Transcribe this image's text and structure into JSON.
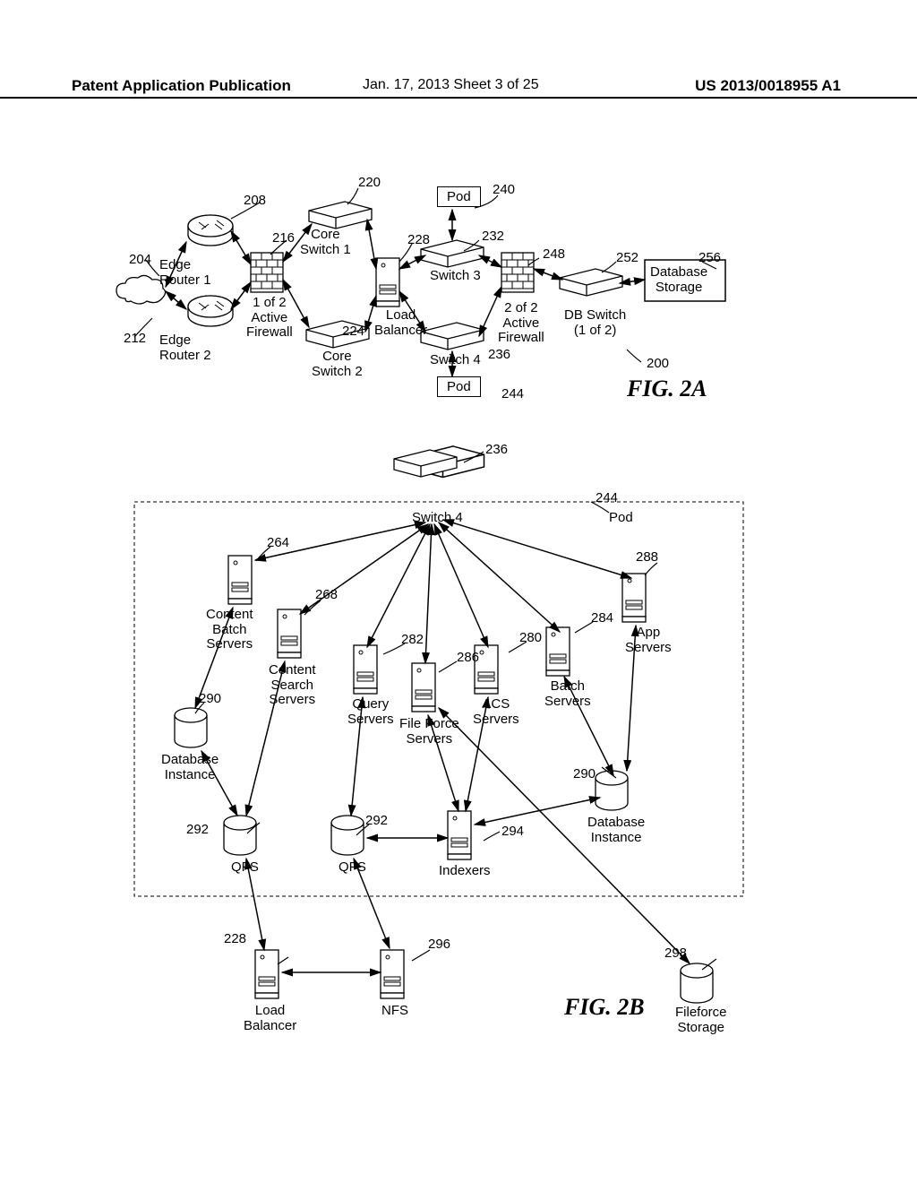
{
  "header": {
    "left": "Patent Application Publication",
    "mid": "Jan. 17, 2013  Sheet 3 of 25",
    "right": "US 2013/0018955 A1"
  },
  "fig2a": {
    "title": "FIG. 2A",
    "systemRef": "200",
    "pod": "Pod",
    "edgeRouter1": {
      "label": "Edge\nRouter 1",
      "ref": "204"
    },
    "cloud": {
      "ref": "212"
    },
    "edgeRouter2": {
      "label": "Edge\nRouter 2",
      "ref": "208"
    },
    "firewall1": {
      "label": "1 of 2\nActive\nFirewall",
      "ref": "216"
    },
    "coreSwitch1": {
      "label": "Core\nSwitch 1",
      "ref": "220"
    },
    "coreSwitch2": {
      "label": "Core\nSwitch 2",
      "ref": "224"
    },
    "loadBalancer": {
      "label": "Load\nBalancer",
      "ref": "228"
    },
    "switch3": {
      "label": "Switch 3",
      "ref": "232"
    },
    "switch4": {
      "label": "Switch 4",
      "ref": "236"
    },
    "pod1": {
      "label": "Pod",
      "ref": "240"
    },
    "pod2": {
      "label": "Pod",
      "ref": "244"
    },
    "firewall2": {
      "label": "2 of 2\nActive\nFirewall",
      "ref": "248"
    },
    "dbSwitch": {
      "label": "DB Switch\n(1 of 2)",
      "ref": "252"
    },
    "dbStorage": {
      "label": "Database\nStorage",
      "ref": "256"
    }
  },
  "fig2b": {
    "title": "FIG. 2B",
    "switch4": {
      "label": "Switch 4",
      "ref": "236"
    },
    "pod": {
      "label": "Pod",
      "ref": "244"
    },
    "contentBatch": {
      "label": "Content\nBatch\nServers",
      "ref": "264"
    },
    "contentSearch": {
      "label": "Content\nSearch\nServers",
      "ref": "268"
    },
    "query": {
      "label": "Query\nServers",
      "ref": "282"
    },
    "fileForce": {
      "label": "File Force\nServers",
      "ref": "286"
    },
    "acs": {
      "label": "ACS\nServers",
      "ref": "280"
    },
    "batch": {
      "label": "Batch\nServers",
      "ref": "284"
    },
    "app": {
      "label": "App\nServers",
      "ref": "288"
    },
    "dbInst1": {
      "label": "Database\nInstance",
      "ref": "290"
    },
    "dbInst2": {
      "label": "Database\nInstance",
      "ref": "290"
    },
    "qfs1": {
      "label": "QFS",
      "ref": "292"
    },
    "qfs2": {
      "label": "QFS",
      "ref": "292"
    },
    "indexers": {
      "label": "Indexers",
      "ref": "294"
    },
    "loadBalancer": {
      "label": "Load\nBalancer",
      "ref": "228"
    },
    "nfs": {
      "label": "NFS",
      "ref": "296"
    },
    "fileforceStorage": {
      "label": "Fileforce\nStorage",
      "ref": "298"
    }
  }
}
